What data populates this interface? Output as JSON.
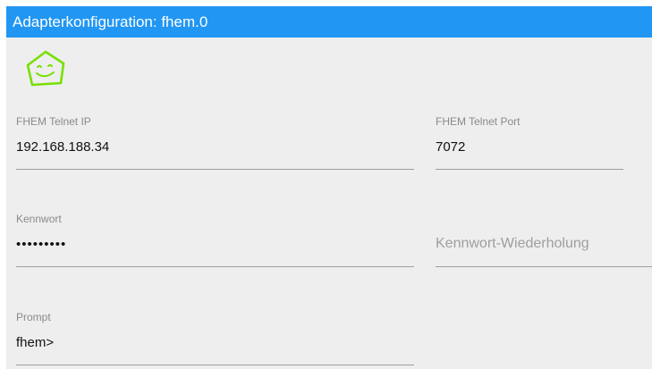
{
  "window": {
    "title": "Adapterkonfiguration: fhem.0",
    "header_color": "#2196f3",
    "background_color": "#eeeeee"
  },
  "logo": {
    "icon": "smiley-house-icon",
    "color": "#76e000"
  },
  "fields": {
    "telnet_ip": {
      "label": "FHEM Telnet IP",
      "value": "192.168.188.34"
    },
    "telnet_port": {
      "label": "FHEM Telnet Port",
      "value": "7072"
    },
    "password": {
      "label": "Kennwort",
      "value": "•••••••••"
    },
    "password_repeat": {
      "placeholder": "Kennwort-Wiederholung",
      "value": ""
    },
    "prompt": {
      "label": "Prompt",
      "value": "fhem>"
    }
  }
}
